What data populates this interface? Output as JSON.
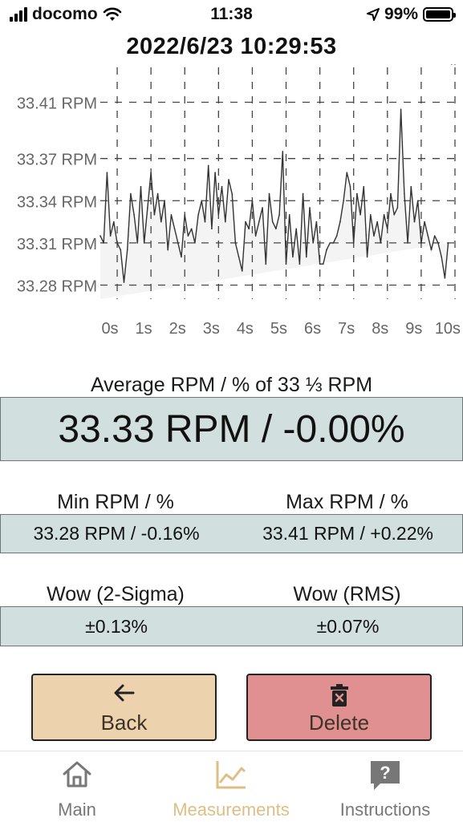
{
  "status_bar": {
    "carrier": "docomo",
    "time": "11:38",
    "battery": "99%",
    "battery_level": 0.99
  },
  "measurement_timestamp": "2022/6/23 10:29:53",
  "chart_data": {
    "type": "area",
    "ytick_labels": [
      "33.41 RPM",
      "33.37 RPM",
      "33.34 RPM",
      "33.31 RPM",
      "33.28 RPM"
    ],
    "ytick_values": [
      33.41,
      33.37,
      33.34,
      33.31,
      33.28
    ],
    "xtick_labels": [
      "0s",
      "1s",
      "2s",
      "3s",
      "4s",
      "5s",
      "6s",
      "7s",
      "8s",
      "9s",
      "10s"
    ],
    "xlim": [
      0,
      10.5
    ],
    "ylim": [
      33.27,
      33.42
    ],
    "grid": true,
    "color": "#333333",
    "fill": "#f4f4f4",
    "x": [
      0.0,
      0.1,
      0.2,
      0.3,
      0.4,
      0.5,
      0.6,
      0.7,
      0.8,
      0.9,
      1.0,
      1.1,
      1.2,
      1.3,
      1.4,
      1.5,
      1.6,
      1.7,
      1.8,
      1.9,
      2.0,
      2.1,
      2.2,
      2.3,
      2.4,
      2.5,
      2.6,
      2.7,
      2.8,
      2.9,
      3.0,
      3.1,
      3.2,
      3.3,
      3.4,
      3.5,
      3.6,
      3.7,
      3.8,
      3.9,
      4.0,
      4.1,
      4.2,
      4.3,
      4.4,
      4.5,
      4.6,
      4.7,
      4.8,
      4.9,
      5.0,
      5.1,
      5.2,
      5.3,
      5.4,
      5.5,
      5.6,
      5.7,
      5.8,
      5.9,
      6.0,
      6.1,
      6.2,
      6.3,
      6.4,
      6.5,
      6.6,
      6.7,
      6.8,
      6.9,
      7.0,
      7.1,
      7.2,
      7.3,
      7.4,
      7.5,
      7.6,
      7.7,
      7.8,
      7.9,
      8.0,
      8.1,
      8.2,
      8.3,
      8.4,
      8.5,
      8.6,
      8.7,
      8.8,
      8.9,
      9.0,
      9.1,
      9.2,
      9.3,
      9.4,
      9.5,
      9.6,
      9.7,
      9.8,
      9.9,
      10.0,
      10.1,
      10.2,
      10.3,
      10.4,
      10.5
    ],
    "y": [
      33.315,
      33.31,
      33.36,
      33.315,
      33.325,
      33.31,
      33.305,
      33.282,
      33.305,
      33.345,
      33.33,
      33.31,
      33.35,
      33.31,
      33.335,
      33.36,
      33.33,
      33.345,
      33.325,
      33.34,
      33.305,
      33.33,
      33.32,
      33.31,
      33.3,
      33.33,
      33.315,
      33.32,
      33.31,
      33.33,
      33.34,
      33.325,
      33.365,
      33.32,
      33.36,
      33.33,
      33.35,
      33.325,
      33.355,
      33.345,
      33.31,
      33.3,
      33.29,
      33.325,
      33.32,
      33.34,
      33.315,
      33.325,
      33.335,
      33.295,
      33.345,
      33.325,
      33.32,
      33.33,
      33.375,
      33.295,
      33.33,
      33.3,
      33.32,
      33.295,
      33.345,
      33.3,
      33.335,
      33.31,
      33.325,
      33.295,
      33.295,
      33.305,
      33.31,
      33.31,
      33.315,
      33.325,
      33.34,
      33.36,
      33.35,
      33.31,
      33.345,
      33.33,
      33.35,
      33.3,
      33.33,
      33.315,
      33.325,
      33.31,
      33.33,
      33.32,
      33.345,
      33.33,
      33.335,
      33.405,
      33.345,
      33.31,
      33.35,
      33.325,
      33.34,
      33.31,
      33.325,
      33.315,
      33.305,
      33.315,
      33.31,
      33.3,
      33.285,
      33.31
    ]
  },
  "average": {
    "label": "Average RPM / % of 33 ⅓ RPM",
    "value": "33.33 RPM / -0.00%"
  },
  "min": {
    "label": "Min RPM / %",
    "value": "33.28 RPM / -0.16%"
  },
  "max": {
    "label": "Max RPM / %",
    "value": "33.41 RPM / +0.22%"
  },
  "wow_2sigma": {
    "label": "Wow (2-Sigma)",
    "value": "±0.13%"
  },
  "wow_rms": {
    "label": "Wow (RMS)",
    "value": "±0.07%"
  },
  "buttons": {
    "back": "Back",
    "delete": "Delete"
  },
  "tabs": {
    "main": "Main",
    "measurements": "Measurements",
    "instructions": "Instructions"
  },
  "icons": {
    "back": "arrow-left-icon",
    "delete": "trash-icon",
    "main": "home-icon",
    "measurements": "line-chart-icon",
    "instructions": "question-icon"
  },
  "colors": {
    "panel": "#d2dfdf",
    "back_button": "#ecd3ae",
    "delete_button": "#e09090",
    "active_tab": "#dcbf86"
  }
}
